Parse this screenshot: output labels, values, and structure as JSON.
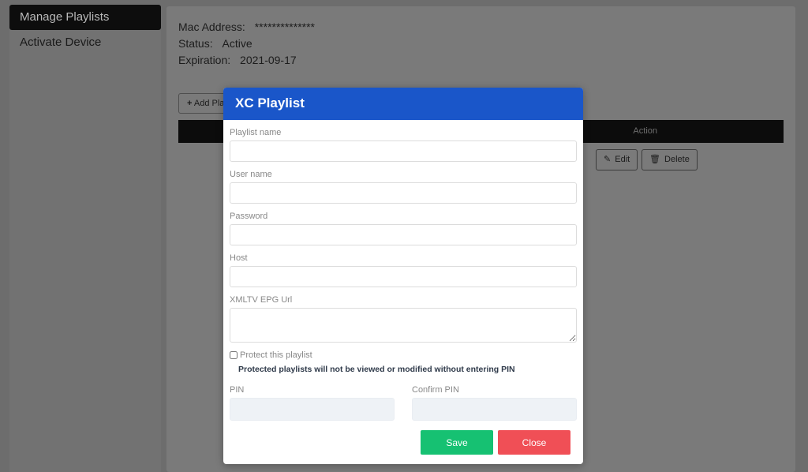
{
  "sidebar": {
    "items": [
      {
        "label": "Manage Playlists"
      },
      {
        "label": "Activate Device"
      }
    ]
  },
  "device": {
    "mac_label": "Mac Address:",
    "mac_value": "**************",
    "status_label": "Status:",
    "status_value": "Active",
    "expiration_label": "Expiration:",
    "expiration_value": "2021-09-17"
  },
  "playlists": {
    "add_label": "Add Pla",
    "action_header": "Action",
    "edit_label": "Edit",
    "delete_label": "Delete"
  },
  "modal": {
    "title": "XC Playlist",
    "playlist_name_label": "Playlist name",
    "playlist_name_value": "",
    "user_name_label": "User name",
    "user_name_value": "",
    "password_label": "Password",
    "password_value": "",
    "host_label": "Host",
    "host_value": "",
    "epg_label": "XMLTV EPG Url",
    "epg_value": "",
    "protect_label": "Protect this playlist",
    "protect_checked": false,
    "protect_note": "Protected playlists will not be viewed or modified without entering PIN",
    "pin_label": "PIN",
    "confirm_pin_label": "Confirm PIN",
    "save_label": "Save",
    "close_label": "Close"
  },
  "colors": {
    "header_blue": "#1a56c9",
    "save_green": "#16c172",
    "close_red": "#f04f56"
  }
}
